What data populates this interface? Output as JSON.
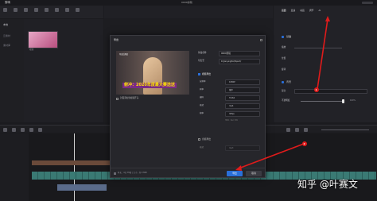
{
  "app": {
    "title": "剪映",
    "center_title": "0000剪辑"
  },
  "top_tabs": [
    "媒体",
    "音频",
    "文本",
    "贴纸",
    "特效",
    "转场",
    "滤镜",
    "调节"
  ],
  "right_tabs": [
    "画面",
    "变速",
    "动画",
    "调节",
    "AI"
  ],
  "left_sidebar": {
    "items": [
      "本地",
      "云素材",
      "素材库"
    ]
  },
  "media": {
    "thumb_label": "视频"
  },
  "right_panel": {
    "section1": "基础",
    "section2": "背景",
    "rows": [
      "缩放",
      "位置",
      "旋转",
      "混合",
      "不透明度"
    ],
    "value_label": "100%"
  },
  "export_dialog": {
    "title": "导出",
    "preview_caption": "俯冲：2020年度最大赛选送",
    "preview_small_text": "导出后预览",
    "cover_label": "封面添加到视频开头",
    "fields": [
      {
        "label": "作品名称",
        "value": "0000剪辑"
      },
      {
        "label": "导出至",
        "value": "D:/JianyingPro/Export/"
      }
    ],
    "video_section": "视频导出",
    "video_rows": [
      {
        "label": "分辨率",
        "value": "1080P"
      },
      {
        "label": "码率",
        "value": "推荐"
      },
      {
        "label": "编码",
        "value": "H.264"
      },
      {
        "label": "格式",
        "value": "mp4"
      },
      {
        "label": "帧率",
        "value": "30fps"
      }
    ],
    "hdr_note": "HDR · Rec.709",
    "audio_section": "音频导出",
    "audio_row": {
      "label": "格式",
      "value": "mp3"
    },
    "footer_info": "时长：4分 35秒 | 大小：约 470M",
    "export_button": "导出",
    "cancel_button": "取消"
  },
  "watermark": "知乎 @叶赛文",
  "annotations": {
    "marker1": "1",
    "marker2": "2"
  },
  "colors": {
    "accent": "#2a6fd9",
    "annotation": "#e01b1b",
    "clip": "#2e6d6a"
  }
}
